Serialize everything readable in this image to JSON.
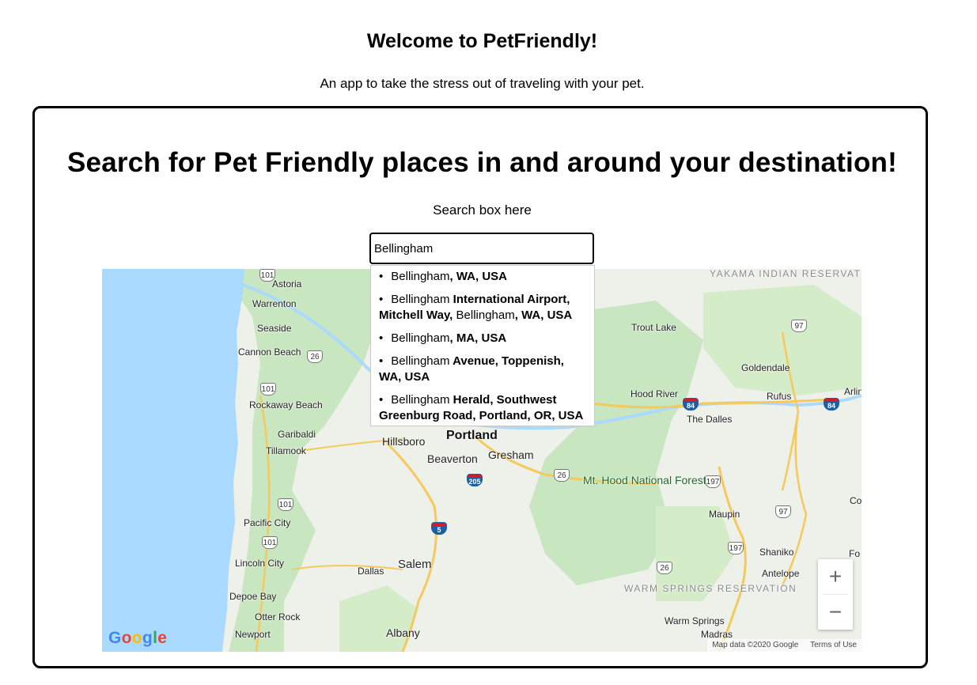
{
  "header": {
    "title": "Welcome to PetFriendly!",
    "tagline": "An app to take the stress out of traveling with your pet."
  },
  "search": {
    "heading": "Search for Pet Friendly places in and around your destination!",
    "caption": "Search box here",
    "value": "Bellingham"
  },
  "suggestions": [
    {
      "match": "Bellingham",
      "rest": ", WA, USA"
    },
    {
      "match": "Bellingham",
      "rest": " International Airport, Mitchell Way,",
      "match2": "Bellingham",
      "rest2": ", WA, USA"
    },
    {
      "match": "Bellingham",
      "rest": ", MA, USA"
    },
    {
      "match": "Bellingham",
      "rest": " Avenue, Toppenish, WA, USA"
    },
    {
      "match": "Bellingham",
      "rest": " Herald, Southwest Greenburg Road, Portland, OR, USA"
    }
  ],
  "map": {
    "labels": {
      "astoria": "Astoria",
      "warrenton": "Warrenton",
      "seaside": "Seaside",
      "cannon_beach": "Cannon Beach",
      "rockaway_beach": "Rockaway Beach",
      "garibaldi": "Garibaldi",
      "tillamook": "Tillamook",
      "pacific_city": "Pacific City",
      "lincoln_city": "Lincoln City",
      "depoe_bay": "Depoe Bay",
      "otter_rock": "Otter Rock",
      "newport": "Newport",
      "hillsboro": "Hillsboro",
      "portland": "Portland",
      "beaverton": "Beaverton",
      "gresham": "Gresham",
      "salem": "Salem",
      "dallas": "Dallas",
      "albany": "Albany",
      "mt_hood": "Mt. Hood National Forest",
      "trout_lake": "Trout Lake",
      "goldendale": "Goldendale",
      "hood_river": "Hood River",
      "rufus": "Rufus",
      "the_dalles": "The Dalles",
      "arlington": "Arlin",
      "maupin": "Maupin",
      "shaniko": "Shaniko",
      "antelope": "Antelope",
      "warm_springs": "Warm Springs",
      "madras": "Madras",
      "co": "Co",
      "fo": "Fo",
      "yakama": "YAKAMA INDIAN RESERVATION",
      "warm_springs_res": "WARM SPRINGS RESERVATION"
    },
    "shields": {
      "r101a": "101",
      "r26a": "26",
      "r101b": "101",
      "r101c": "101",
      "r101d": "101",
      "r26b": "26",
      "r26c": "26",
      "r97a": "97",
      "r97b": "97",
      "r197a": "197",
      "r197b": "197",
      "i84a": "84",
      "i84b": "84",
      "i205": "205",
      "i5": "5"
    },
    "google": "Google",
    "attribution": "Map data ©2020 Google",
    "terms": "Terms of Use",
    "zoom_in": "+",
    "zoom_out": "−"
  },
  "colors": {
    "water": "#aadaff",
    "forest": "#c8e6c0",
    "land": "#eef0ea",
    "highway": "#f5c95c"
  }
}
